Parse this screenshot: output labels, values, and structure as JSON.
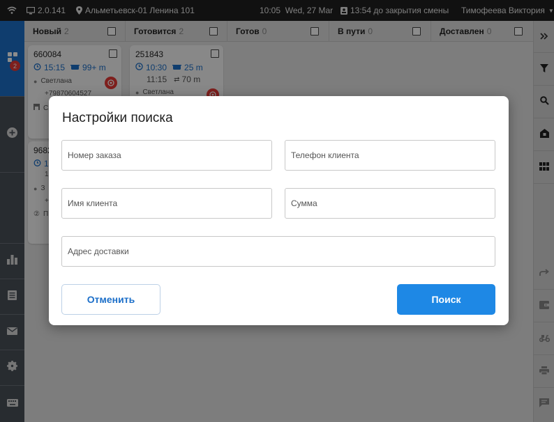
{
  "topbar": {
    "version": "2.0.141",
    "location": "Альметьевск-01 Ленина 101",
    "time": "10:05",
    "date": "Wed, 27 Mar",
    "shift": "13:54 до закрытия смены",
    "user": "Тимофеева Виктория"
  },
  "leftbar": {
    "orders_badge": "2"
  },
  "columns": [
    {
      "label": "Новый",
      "count": "2"
    },
    {
      "label": "Готовится",
      "count": "2"
    },
    {
      "label": "Готов",
      "count": "0"
    },
    {
      "label": "В пути",
      "count": "0"
    },
    {
      "label": "Доставлен",
      "count": "0"
    }
  ],
  "cards": {
    "new_1": {
      "number": "660084",
      "time": "15:15",
      "distance": "99+ m",
      "client": "Светлана",
      "phone": "+79870604527",
      "extra": "С"
    },
    "new_2": {
      "number": "9682",
      "time": "1",
      "line3": "1",
      "client": "З",
      "phone": "+",
      "people": "П"
    },
    "cooking_1": {
      "number": "251843",
      "time": "10:30",
      "cook_time": "25 m",
      "time2": "11:15",
      "distance": "70 m",
      "client": "Светлана"
    }
  },
  "dialog": {
    "title": "Настройки поиска",
    "order_number_placeholder": "Номер заказа",
    "client_phone_placeholder": "Телефон клиента",
    "client_name_placeholder": "Имя клиента",
    "sum_placeholder": "Сумма",
    "address_placeholder": "Адрес доставки",
    "cancel_label": "Отменить",
    "search_label": "Поиск"
  },
  "colors": {
    "accent": "#1e88e5",
    "badge": "#e53935",
    "sidebar": "#4a5058",
    "active": "#1c6fc9"
  }
}
